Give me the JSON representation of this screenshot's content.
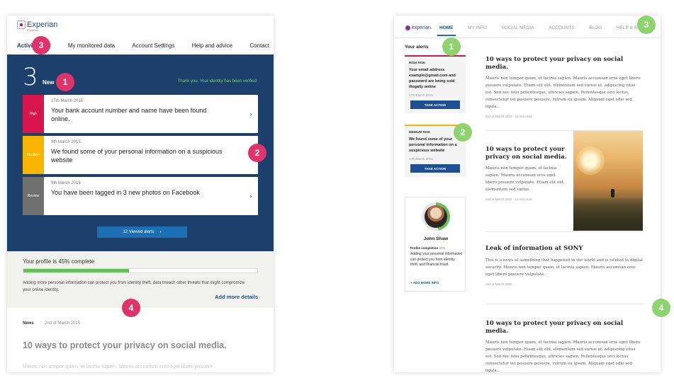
{
  "left": {
    "logo": {
      "text": "Experian",
      "sub": "Experian"
    },
    "nav": [
      "Activity feed",
      "My monitored data",
      "Account Settings",
      "Help and advice",
      "Contact"
    ],
    "hero": {
      "count": "3",
      "new_label": "New",
      "verified": "Thank you. Your identity has been verified"
    },
    "alerts": [
      {
        "severity": "High",
        "color": "#d6164d",
        "date": "17th March 2015",
        "text": "Your bank account number and name have been found online."
      },
      {
        "severity": "Medium",
        "color": "#f7b500",
        "date": "9th March 2015",
        "text": "We found some of your personal information on a suspicious website"
      },
      {
        "severity": "Review",
        "color": "#6f6f6f",
        "date": "9th March 2015",
        "text": "You have been tagged in 3 new photos on Facebook"
      }
    ],
    "chevron": "›",
    "viewed_alerts": "12 Viewed alerts",
    "profile": {
      "title": "Your profile is 45% complete",
      "percent": 45,
      "desc": "Adding more personal information can protect you from identity theft, data breach other threats that might compromize your online identity.",
      "add_more": "Add more details"
    },
    "news": {
      "tag": "News",
      "date": "2nd of March 2015",
      "title": "10 ways to protect your privacy on social media.",
      "body": "Mauris non tempor quam, et lacinia sapien. Mauris accumsan eros eget libero posuere"
    }
  },
  "right": {
    "logo": "experian.",
    "nav": [
      "HOME",
      "MY INFO",
      "SOCIAL MEDIA",
      "ACCOUNTS",
      "BLOG",
      "HELP & SUPPORT"
    ],
    "your_alerts": "Your alerts",
    "alerts": [
      {
        "risk": "HIGH RISK",
        "color": "#d6164d",
        "desc": "Your email address example@gmail.com and password are being sold illegally online",
        "date": "17th March 2015",
        "action": "TAKE ACTION"
      },
      {
        "risk": "MEDIUM RISK",
        "color": "#f7b500",
        "desc": "We found some of your personal information on a suspicious website",
        "date": "17th March 2015",
        "action": "TAKE ACTION"
      }
    ],
    "profile_card": {
      "name": "John Shaw",
      "completion_label": "Profile completion",
      "completion_pct": "47%",
      "desc": "Adding your personal information can protect you from identity theft, and financial fraud.",
      "add_more": "+ ADD MORE INFO"
    },
    "articles": [
      {
        "title": "10 ways to protect your privacy on social media.",
        "body": "Mauris non tempor quam, et lacinia sapien. Mauris accumsan eros eget libero posuere vulputate. Etiam elit elit, elementum sed varius at, adipiscing vitae est. Sed nec felis pellentesque, ultricies sapien. Pellentesque orci lectus, consectetur vel posuere posuere, rutrum eu ipsum. Aliquam eget odio sed ligula...",
        "meta": "2nd of March 2015 · 10 min read"
      },
      {
        "title": "10 ways to protect your privacy on social media.",
        "body": "Mauris non tempor quam, et lacinia sapien. Mauris accumsan eros eget libero posuere vulputate. Etiam elit elit, elementum sed varius.",
        "meta": "2nd of March 2015 · 10 min read"
      },
      {
        "title": "Leak of information at SONY",
        "body": "This is a news of something that happened in the world and is related to digital security. Mauris non tempor quam, et lacinia sapien. Mauris accumsan eros eget libero posuere vulputate.",
        "meta": "2nd of March 2015"
      },
      {
        "title": "10 ways to protect your privacy on social media.",
        "body": "Mauris non tempor quam, et lacinia sapien. Mauris accumsan eros eget libero posuere vulputate. Etiam elit elit, elementum sed varius at, adipiscing vitae est. Sed nec felis pellentesque, ultricies sapien. Pellentesque orci lectus, consectetur vel posuere posuere, rutrum eu ipsum. Aliquam eget odio sed ligula...",
        "meta": ""
      }
    ]
  },
  "badges": {
    "one": "1",
    "two": "2",
    "three": "3",
    "four": "4"
  }
}
